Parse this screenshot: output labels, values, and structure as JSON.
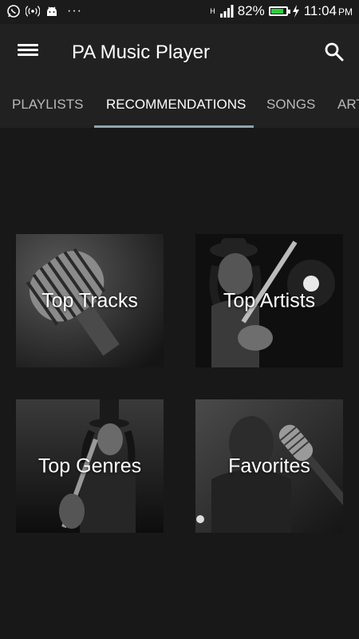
{
  "status_bar": {
    "left_icons": [
      "whatsapp-icon",
      "hotspot-icon",
      "android-icon"
    ],
    "overflow": "···",
    "network_label": "H",
    "battery_percent": "82%",
    "battery_level": 0.82,
    "time": "11:04",
    "ampm": "PM",
    "colors": {
      "battery": "#2ecc40"
    }
  },
  "app_bar": {
    "title": "PA Music Player",
    "menu_icon": "hamburger-menu-icon",
    "search_icon": "search-icon"
  },
  "tabs": [
    {
      "label": "PLAYLISTS",
      "active": false
    },
    {
      "label": "RECOMMENDATIONS",
      "active": true
    },
    {
      "label": "SONGS",
      "active": false
    },
    {
      "label": "ARTISTS",
      "active": false
    }
  ],
  "tiles": [
    {
      "label": "Top Tracks",
      "image": "vintage-microphone"
    },
    {
      "label": "Top Artists",
      "image": "guitarist-with-hat"
    },
    {
      "label": "Top Genres",
      "image": "guitarist-top-hat"
    },
    {
      "label": "Favorites",
      "image": "singer-with-microphone"
    }
  ],
  "colors": {
    "background": "#181818",
    "toolbar": "#212121",
    "tab_indicator": "#90a4ae"
  }
}
